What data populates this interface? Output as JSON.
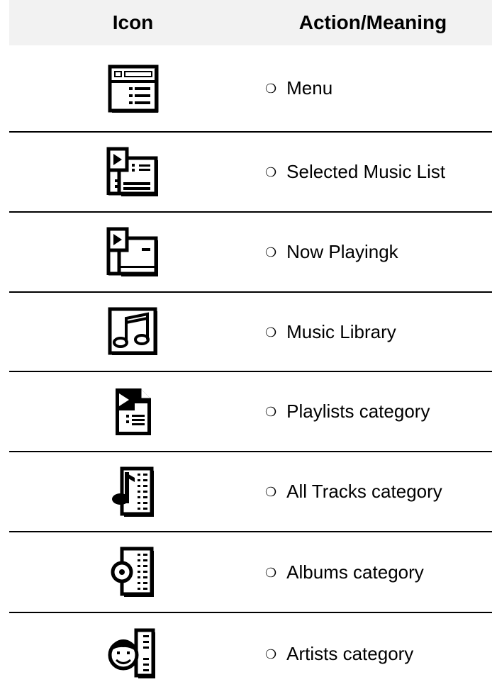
{
  "header": {
    "icon_col": "Icon",
    "action_col": "Action/Meaning"
  },
  "rows": [
    {
      "bullet": "❍",
      "label": "Menu",
      "icon": "menu-icon"
    },
    {
      "bullet": "❍",
      "label": "Selected Music List",
      "icon": "selected-music-list-icon"
    },
    {
      "bullet": "❍",
      "label": "Now Playingk",
      "icon": "now-playing-icon"
    },
    {
      "bullet": "❍",
      "label": "Music Library",
      "icon": "music-library-icon"
    },
    {
      "bullet": "❍",
      "label": "Playlists category",
      "icon": "playlists-icon"
    },
    {
      "bullet": "❍",
      "label": "All Tracks category",
      "icon": "all-tracks-icon"
    },
    {
      "bullet": "❍",
      "label": "Albums category",
      "icon": "albums-icon"
    },
    {
      "bullet": "❍",
      "label": "Artists category",
      "icon": "artists-icon"
    }
  ]
}
